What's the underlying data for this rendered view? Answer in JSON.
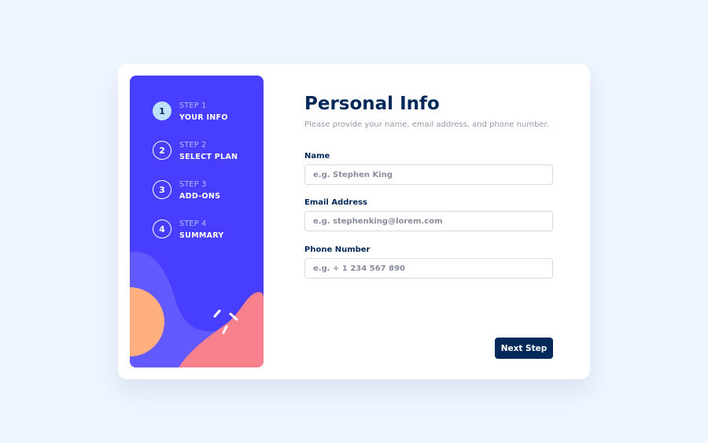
{
  "sidebar": {
    "steps": [
      {
        "number": "1",
        "label": "STEP 1",
        "name": "YOUR INFO",
        "active": true
      },
      {
        "number": "2",
        "label": "STEP 2",
        "name": "SELECT PLAN",
        "active": false
      },
      {
        "number": "3",
        "label": "STEP 3",
        "name": "ADD-ONS",
        "active": false
      },
      {
        "number": "4",
        "label": "STEP 4",
        "name": "SUMMARY",
        "active": false
      }
    ]
  },
  "main": {
    "title": "Personal Info",
    "subtitle": "Please provide your name, email address, and phone number.",
    "fields": {
      "name": {
        "label": "Name",
        "placeholder": "e.g. Stephen King",
        "value": ""
      },
      "email": {
        "label": "Email Address",
        "placeholder": "e.g. stephenking@lorem.com",
        "value": ""
      },
      "phone": {
        "label": "Phone Number",
        "placeholder": "e.g. + 1 234 567 890",
        "value": ""
      }
    },
    "next_label": "Next Step"
  },
  "colors": {
    "page_background": "#eef5fe",
    "sidebar_background": "#483eff",
    "active_step": "#bee2fd",
    "primary_dark": "#022959",
    "orange_shape": "#ffaf7e",
    "pink_shape": "#f9818e",
    "lavender_shape": "#6259ff"
  },
  "icons": {
    "decoration": "sparkle-lines"
  }
}
